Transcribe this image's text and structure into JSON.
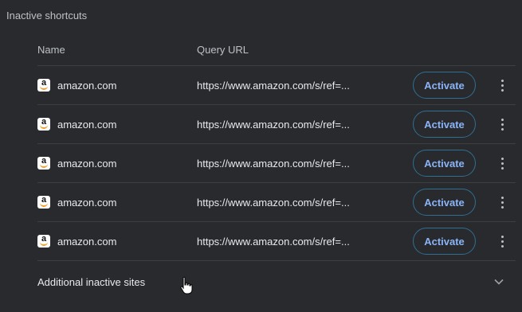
{
  "section": {
    "title": "Inactive shortcuts"
  },
  "table": {
    "headers": {
      "name": "Name",
      "query_url": "Query URL"
    },
    "rows": [
      {
        "name": "amazon.com",
        "url": "https://www.amazon.com/s/ref=...",
        "action": "Activate",
        "icon": "amazon-favicon"
      },
      {
        "name": "amazon.com",
        "url": "https://www.amazon.com/s/ref=...",
        "action": "Activate",
        "icon": "amazon-favicon"
      },
      {
        "name": "amazon.com",
        "url": "https://www.amazon.com/s/ref=...",
        "action": "Activate",
        "icon": "amazon-favicon"
      },
      {
        "name": "amazon.com",
        "url": "https://www.amazon.com/s/ref=...",
        "action": "Activate",
        "icon": "amazon-favicon"
      },
      {
        "name": "amazon.com",
        "url": "https://www.amazon.com/s/ref=...",
        "action": "Activate",
        "icon": "amazon-favicon"
      }
    ]
  },
  "additional": {
    "label": "Additional inactive sites",
    "icon": "chevron-down-icon"
  },
  "colors": {
    "background": "#292a2d",
    "accent": "#8ab4f8",
    "button_border": "#2f6f93",
    "divider": "#3c4043",
    "amazon_smile": "#f79b20"
  }
}
